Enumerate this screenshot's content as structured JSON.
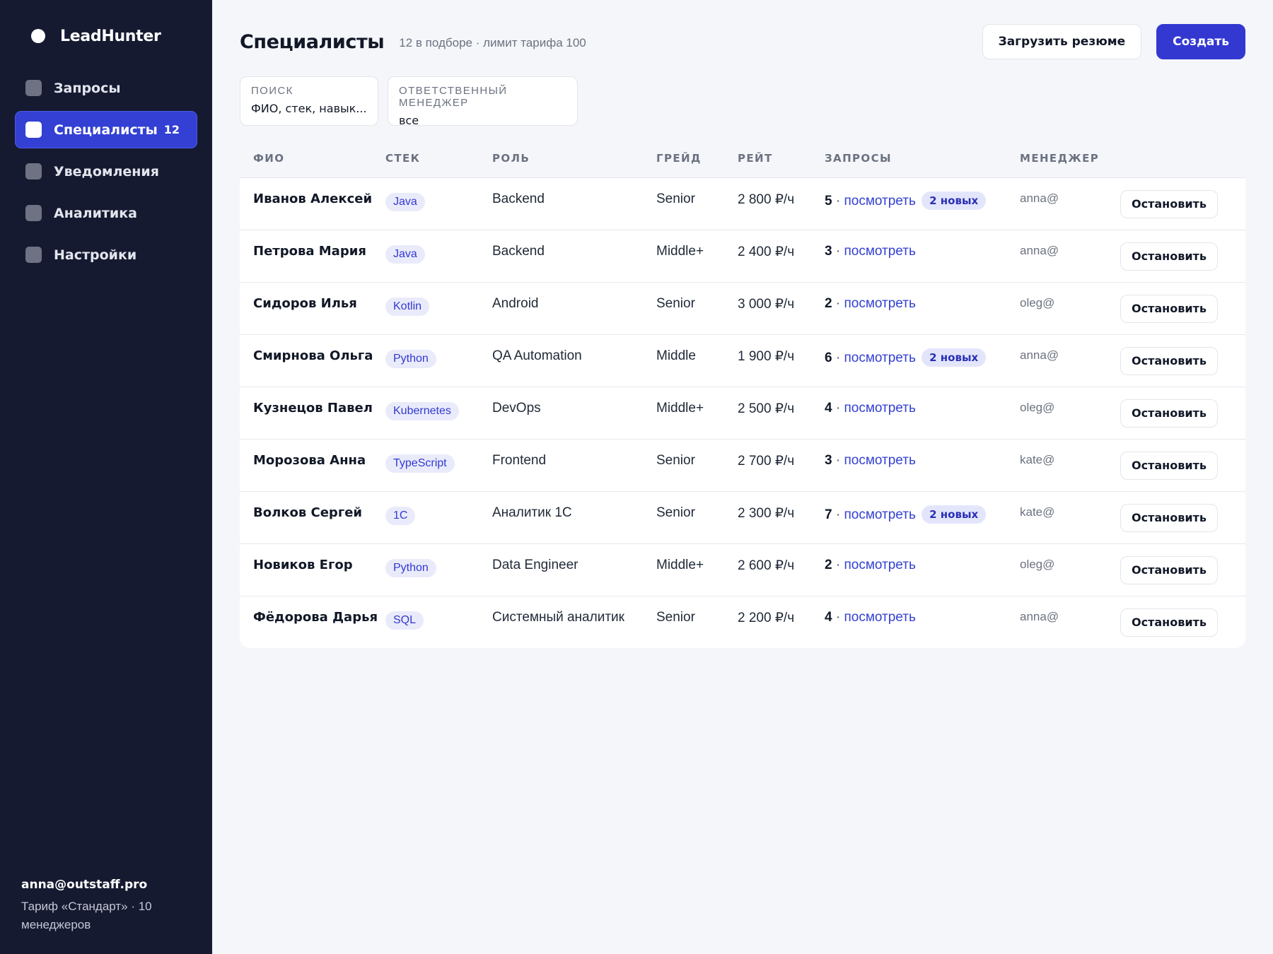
{
  "sidebar": {
    "brand": "LeadHunter",
    "items": [
      {
        "label": "Запросы",
        "count": ""
      },
      {
        "label": "Специалисты",
        "count": "12",
        "active": true
      },
      {
        "label": "Уведомления",
        "count": ""
      },
      {
        "label": "Аналитика",
        "count": ""
      },
      {
        "label": "Настройки",
        "count": ""
      }
    ],
    "user_email": "anna@outstaff.pro",
    "user_plan": "Тариф «Стандарт» · 10 менеджеров"
  },
  "header": {
    "title": "Специалисты",
    "subtitle": "12 в подборе · лимит тарифа 100",
    "upload_label": "Загрузить резюме",
    "create_label": "Создать"
  },
  "filters": {
    "search": {
      "label": "Поиск",
      "value": "ФИО, стек, навык..."
    },
    "manager": {
      "label": "Ответственный менеджер",
      "value": "все"
    }
  },
  "table": {
    "columns": [
      "ФИО",
      "СТЕК",
      "РОЛЬ",
      "ГРЕЙД",
      "РЕЙТ",
      "ЗАПРОСЫ",
      "МЕНЕДЖЕР",
      ""
    ],
    "view_label": "посмотреть",
    "stop_label": "Остановить",
    "rows": [
      {
        "name": "Иванов Алексей",
        "stack": "Java",
        "role": "Backend",
        "grade": "Senior",
        "rate": "2 800 ₽/ч",
        "requests": "5",
        "new": "2 новых",
        "manager": "anna@"
      },
      {
        "name": "Петрова Мария",
        "stack": "Java",
        "role": "Backend",
        "grade": "Middle+",
        "rate": "2 400 ₽/ч",
        "requests": "3",
        "new": "",
        "manager": "anna@"
      },
      {
        "name": "Сидоров Илья",
        "stack": "Kotlin",
        "role": "Android",
        "grade": "Senior",
        "rate": "3 000 ₽/ч",
        "requests": "2",
        "new": "",
        "manager": "oleg@"
      },
      {
        "name": "Смирнова Ольга",
        "stack": "Python",
        "role": "QA Automation",
        "grade": "Middle",
        "rate": "1 900 ₽/ч",
        "requests": "6",
        "new": "2 новых",
        "manager": "anna@"
      },
      {
        "name": "Кузнецов Павел",
        "stack": "Kubernetes",
        "role": "DevOps",
        "grade": "Middle+",
        "rate": "2 500 ₽/ч",
        "requests": "4",
        "new": "",
        "manager": "oleg@"
      },
      {
        "name": "Морозова Анна",
        "stack": "TypeScript",
        "role": "Frontend",
        "grade": "Senior",
        "rate": "2 700 ₽/ч",
        "requests": "3",
        "new": "",
        "manager": "kate@"
      },
      {
        "name": "Волков Сергей",
        "stack": "1С",
        "role": "Аналитик 1С",
        "grade": "Senior",
        "rate": "2 300 ₽/ч",
        "requests": "7",
        "new": "2 новых",
        "manager": "kate@"
      },
      {
        "name": "Новиков Егор",
        "stack": "Python",
        "role": "Data Engineer",
        "grade": "Middle+",
        "rate": "2 600 ₽/ч",
        "requests": "2",
        "new": "",
        "manager": "oleg@"
      },
      {
        "name": "Фёдорова Дарья",
        "stack": "SQL",
        "role": "Системный аналитик",
        "grade": "Senior",
        "rate": "2 200 ₽/ч",
        "requests": "4",
        "new": "",
        "manager": "anna@"
      }
    ]
  },
  "colors": {
    "sidebar_bg": "#161a31",
    "accent": "#3338d1",
    "page_bg": "#f5f6fa"
  }
}
